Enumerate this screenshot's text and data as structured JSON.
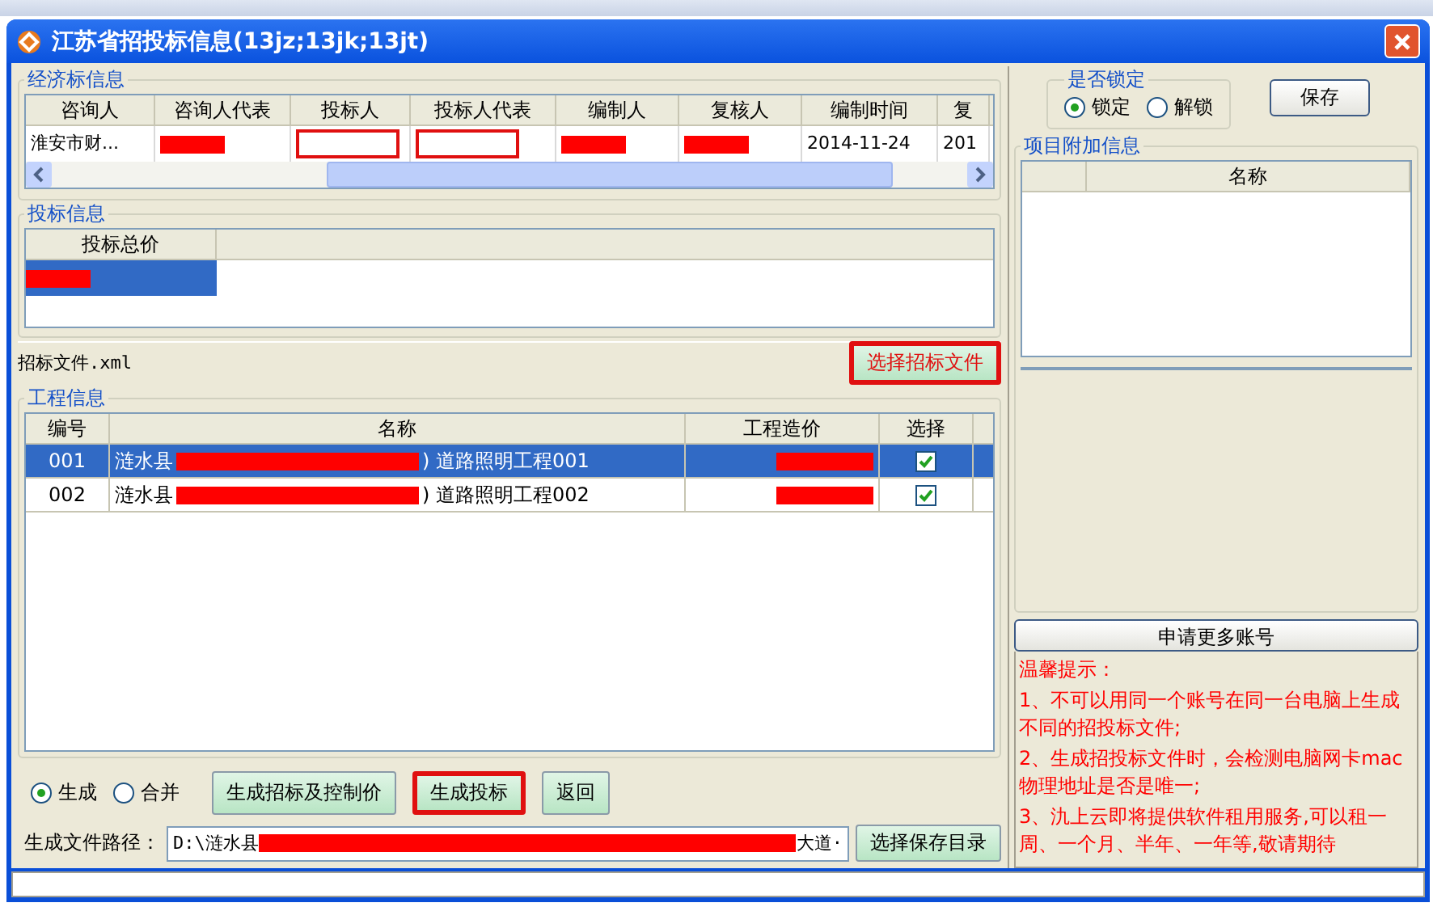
{
  "window": {
    "title": "江苏省招投标信息(13jz;13jk;13jt)"
  },
  "economic_bid": {
    "title": "经济标信息",
    "columns": [
      "咨询人",
      "咨询人代表",
      "投标人",
      "投标人代表",
      "编制人",
      "复核人",
      "编制时间",
      "复"
    ],
    "rows": [
      [
        {
          "kind": "text",
          "text": "淮安市财..."
        },
        {
          "kind": "redacted"
        },
        {
          "kind": "outlined"
        },
        {
          "kind": "outlined"
        },
        {
          "kind": "redacted"
        },
        {
          "kind": "redacted"
        },
        {
          "kind": "text",
          "text": "2014-11-24"
        },
        {
          "kind": "text",
          "text": "201"
        }
      ]
    ]
  },
  "bid_info": {
    "title": "投标信息",
    "columns": [
      "投标总价"
    ],
    "rows": [
      {
        "selected": true,
        "redacted": true
      }
    ]
  },
  "bid_file": {
    "name": "招标文件.xml",
    "button": "选择招标文件"
  },
  "project_info": {
    "title": "工程信息",
    "columns": [
      "编号",
      "名称",
      "工程造价",
      "选择"
    ],
    "rows": [
      {
        "id": "001",
        "name_start": "涟水县",
        "name_end": ") 道路照明工程001",
        "selected": true,
        "checked": true
      },
      {
        "id": "002",
        "name_start": "涟水县",
        "name_end": ") 道路照明工程002",
        "selected": false,
        "checked": true
      }
    ]
  },
  "mode": [
    {
      "label": "生成",
      "selected": true
    },
    {
      "label": "合并",
      "selected": false
    }
  ],
  "actions": [
    {
      "label": "生成招标及控制价",
      "highlighted": false
    },
    {
      "label": "生成投标",
      "highlighted": true
    },
    {
      "label": "返回",
      "highlighted": false
    }
  ],
  "output_path": {
    "label": "生成文件路径：",
    "value_start": "D:\\涟水县",
    "value_end": "大道·",
    "button": "选择保存目录"
  },
  "lock": {
    "title": "是否锁定",
    "options": [
      {
        "label": "锁定",
        "selected": true
      },
      {
        "label": "解锁",
        "selected": false
      }
    ],
    "save": "保存"
  },
  "extra_info": {
    "title": "项目附加信息",
    "columns": [
      "名称"
    ]
  },
  "more_accounts": "申请更多账号",
  "tips": [
    "温馨提示：",
    "1、不可以用同一个账号在同一台电脑上生成不同的招投标文件;",
    "2、生成招投标文件时，会检测电脑网卡mac物理地址是否是唯一;",
    "3、氿上云即将提供软件租用服务,可以租一周、一个月、半年、一年等,敬请期待"
  ]
}
